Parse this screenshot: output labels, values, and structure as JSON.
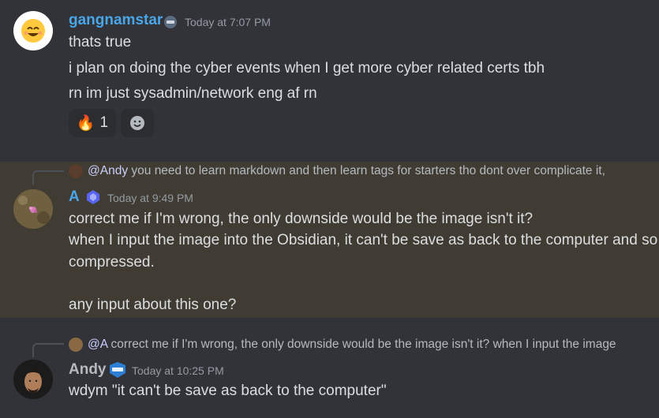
{
  "messages": [
    {
      "author": "gangnamstar",
      "author_color": "#4aa6e8",
      "timestamp": "Today at 7:07 PM",
      "lines": [
        "thats true",
        "i plan on doing the cyber events when I get more cyber related certs tbh",
        "rn im just sysadmin/network eng af rn"
      ],
      "reactions": [
        {
          "emoji": "🔥",
          "count": "1"
        },
        {
          "icon": "add-reaction-icon"
        }
      ]
    },
    {
      "highlighted": true,
      "highlight_color": "#403c33",
      "reply": {
        "mention": "@Andy",
        "text": "you need to learn markdown  and then learn tags  for starters tho dont over complicate it,"
      },
      "author": "A",
      "author_color": "#4aa6e8",
      "timestamp": "Today at 9:49 PM",
      "lines": [
        "correct me if I'm wrong, the only downside would be the image isn't it?",
        "when I input the image into the Obsidian, it can't be save as back to the computer and so",
        "compressed.",
        "",
        "any input about this one?"
      ]
    },
    {
      "reply": {
        "mention": "@A",
        "text": "correct me if I'm wrong, the only downside would be the image isn't it? when I input the image"
      },
      "author": "Andy",
      "author_color": "#b5bac1",
      "timestamp": "Today at 10:25 PM",
      "lines": [
        "wdym \"it can't be save as back to the computer\""
      ]
    }
  ]
}
